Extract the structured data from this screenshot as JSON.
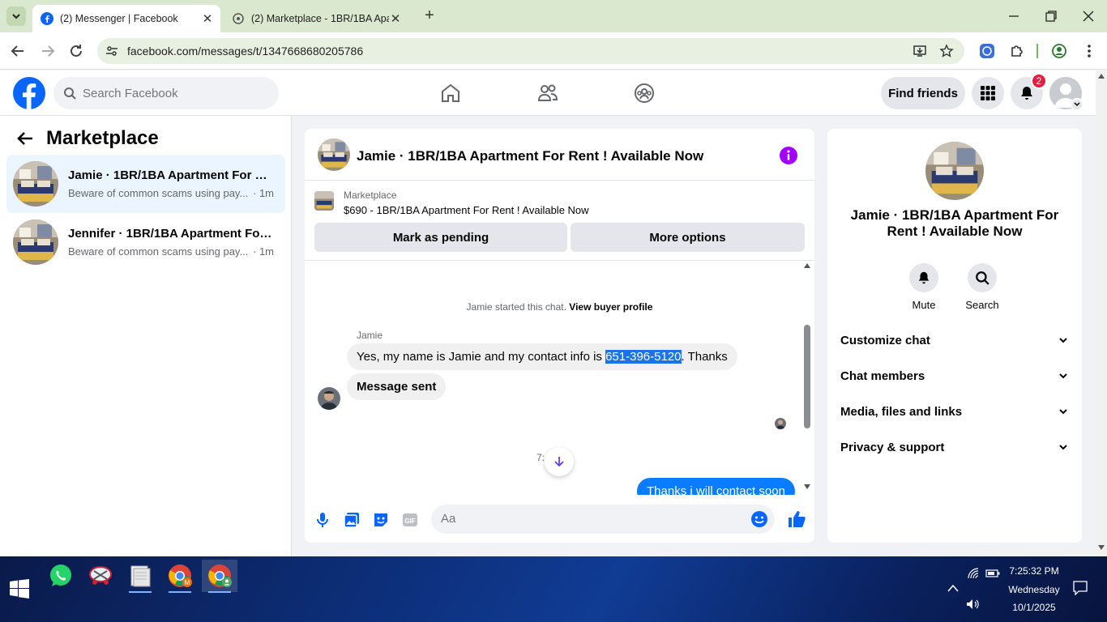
{
  "browser": {
    "tabs": [
      {
        "title": "(2) Messenger | Facebook",
        "active": true
      },
      {
        "title": "(2) Marketplace - 1BR/1BA Apar",
        "active": false
      }
    ],
    "url": "facebook.com/messages/t/1347668680205786"
  },
  "fb_header": {
    "search_placeholder": "Search Facebook",
    "find_friends": "Find friends",
    "notification_count": "2"
  },
  "left": {
    "title": "Marketplace",
    "conversations": [
      {
        "name": "Jamie · 1BR/1BA Apartment For Re...",
        "preview": "Beware of common scams using pay...",
        "time": "· 1m",
        "selected": true
      },
      {
        "name": "Jennifer · 1BR/1BA Apartment For ...",
        "preview": "Beware of common scams using pay...",
        "time": "· 1m",
        "selected": false
      }
    ]
  },
  "chat": {
    "title": "Jamie · 1BR/1BA Apartment For Rent ! Available Now",
    "banner_label": "Marketplace",
    "listing": "$690 - 1BR/1BA Apartment For Rent ! Available Now",
    "mark_pending": "Mark as pending",
    "more_options": "More options",
    "system_text": "Jamie started this chat.",
    "system_link": "View buyer profile",
    "sender": "Jamie",
    "msg1_before": "Yes, my name is Jamie and my contact info is ",
    "msg1_highlight": "651-396-5120",
    "msg1_after": ". Thanks",
    "msg2": "Message sent",
    "time_partial": "7:",
    "my_msg": "Thanks i will contact soon",
    "composer_placeholder": "Aa"
  },
  "right": {
    "title": "Jamie · 1BR/1BA Apartment For Rent ! Available Now",
    "mute": "Mute",
    "search": "Search",
    "rows": [
      "Customize chat",
      "Chat members",
      "Media, files and links",
      "Privacy & support"
    ]
  },
  "taskbar": {
    "time": "7:25:32 PM",
    "day": "Wednesday",
    "date": "10/1/2025"
  },
  "colors": {
    "fb_blue": "#0866ff",
    "messenger_blue": "#0a7cff",
    "selected_row": "#ebf5ff",
    "info_purple": "#a200ff"
  }
}
